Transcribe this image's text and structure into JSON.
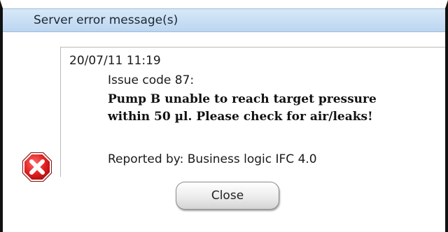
{
  "dialog": {
    "title": "Server error message(s)",
    "close_label": "Close"
  },
  "message": {
    "timestamp": "20/07/11  11:19",
    "issue_code": "Issue code 87:",
    "text": "Pump B unable to reach target pressure within 50 µl. Please check for air/leaks!",
    "reported_by": "Reported by: Business logic IFC 4.0"
  },
  "icons": {
    "error": "error-icon"
  },
  "colors": {
    "title_bar": "#c9def3",
    "error_red": "#d11f1f",
    "border": "#111111"
  }
}
